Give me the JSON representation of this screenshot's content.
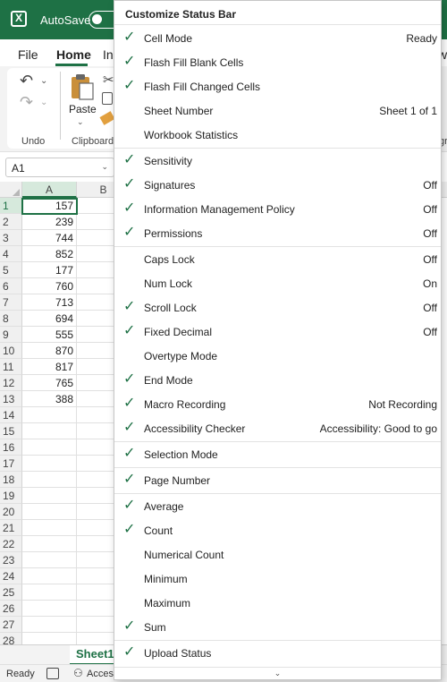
{
  "titlebar": {
    "autosave_label": "AutoSave",
    "toggle_text": "O"
  },
  "tabs": {
    "file": "File",
    "home": "Home",
    "insert_partial": "In",
    "view_partial": "w"
  },
  "ribbon": {
    "undo_group": "Undo",
    "clipboard_group": "Clipboard",
    "paste": "Paste",
    "partial_group": "gr"
  },
  "namebox": {
    "value": "A1"
  },
  "grid": {
    "columns": [
      "A",
      "B"
    ],
    "rows": [
      {
        "n": "1",
        "a": "157"
      },
      {
        "n": "2",
        "a": "239"
      },
      {
        "n": "3",
        "a": "744"
      },
      {
        "n": "4",
        "a": "852"
      },
      {
        "n": "5",
        "a": "177"
      },
      {
        "n": "6",
        "a": "760"
      },
      {
        "n": "7",
        "a": "713"
      },
      {
        "n": "8",
        "a": "694"
      },
      {
        "n": "9",
        "a": "555"
      },
      {
        "n": "10",
        "a": "870"
      },
      {
        "n": "11",
        "a": "817"
      },
      {
        "n": "12",
        "a": "765"
      },
      {
        "n": "13",
        "a": "388"
      },
      {
        "n": "14",
        "a": ""
      },
      {
        "n": "15",
        "a": ""
      },
      {
        "n": "16",
        "a": ""
      },
      {
        "n": "17",
        "a": ""
      },
      {
        "n": "18",
        "a": ""
      },
      {
        "n": "19",
        "a": ""
      },
      {
        "n": "20",
        "a": ""
      },
      {
        "n": "21",
        "a": ""
      },
      {
        "n": "22",
        "a": ""
      },
      {
        "n": "23",
        "a": ""
      },
      {
        "n": "24",
        "a": ""
      },
      {
        "n": "25",
        "a": ""
      },
      {
        "n": "26",
        "a": ""
      },
      {
        "n": "27",
        "a": ""
      },
      {
        "n": "28",
        "a": ""
      }
    ]
  },
  "sheet_tab": "Sheet1",
  "statusbar": {
    "ready": "Ready",
    "accessibility_partial": "Access"
  },
  "menu": {
    "title": "Customize Status Bar",
    "items": [
      {
        "label": "Cell Mode",
        "value": "Ready",
        "checked": true
      },
      {
        "label": "Flash Fill Blank Cells",
        "value": "",
        "checked": true
      },
      {
        "label": "Flash Fill Changed Cells",
        "value": "",
        "checked": true
      },
      {
        "label": "Sheet Number",
        "value": "Sheet 1 of 1",
        "checked": false
      },
      {
        "label": "Workbook Statistics",
        "value": "",
        "checked": false
      },
      {
        "label": "Sensitivity",
        "value": "",
        "checked": true
      },
      {
        "label": "Signatures",
        "value": "Off",
        "checked": true
      },
      {
        "label": "Information Management Policy",
        "value": "Off",
        "checked": true
      },
      {
        "label": "Permissions",
        "value": "Off",
        "checked": true
      },
      {
        "label": "Caps Lock",
        "value": "Off",
        "checked": false
      },
      {
        "label": "Num Lock",
        "value": "On",
        "checked": false
      },
      {
        "label": "Scroll Lock",
        "value": "Off",
        "checked": true
      },
      {
        "label": "Fixed Decimal",
        "value": "Off",
        "checked": true
      },
      {
        "label": "Overtype Mode",
        "value": "",
        "checked": false
      },
      {
        "label": "End Mode",
        "value": "",
        "checked": true
      },
      {
        "label": "Macro Recording",
        "value": "Not Recording",
        "checked": true
      },
      {
        "label": "Accessibility Checker",
        "value": "Accessibility: Good to go",
        "checked": true
      },
      {
        "label": "Selection Mode",
        "value": "",
        "checked": true
      },
      {
        "label": "Page Number",
        "value": "",
        "checked": true
      },
      {
        "label": "Average",
        "value": "",
        "checked": true
      },
      {
        "label": "Count",
        "value": "",
        "checked": true
      },
      {
        "label": "Numerical Count",
        "value": "",
        "checked": false
      },
      {
        "label": "Minimum",
        "value": "",
        "checked": false
      },
      {
        "label": "Maximum",
        "value": "",
        "checked": false
      },
      {
        "label": "Sum",
        "value": "",
        "checked": true
      },
      {
        "label": "Upload Status",
        "value": "",
        "checked": true
      }
    ]
  },
  "colors": {
    "accent": "#1e7145",
    "titlebar": "#1e7145",
    "menu_border": "#c6c6c6"
  }
}
